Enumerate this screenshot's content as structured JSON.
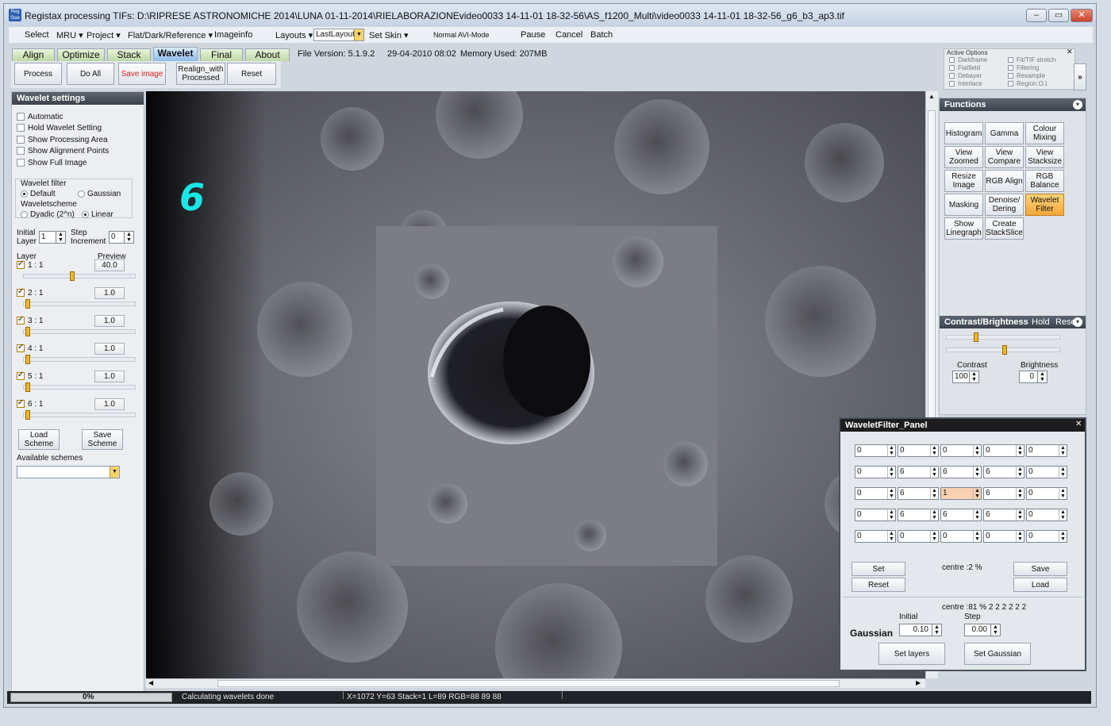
{
  "window": {
    "title": "Registax processing TIFs: D:\\RIPRESE ASTRONOMICHE 2014\\LUNA 01-11-2014\\RIELABORAZIONEvideo0033 14-11-01 18-32-56\\AS_f1200_Multi\\video0033 14-11-01 18-32-56_g6_b3_ap3.tif",
    "minimize": "‒",
    "maximize": "▭",
    "close": "✕"
  },
  "menu": {
    "select": "Select",
    "mru": "MRU ▾",
    "project": "Project ▾",
    "flat": "Flat/Dark/Reference ▾",
    "imageinfo": "Imageinfo",
    "layouts": "Layouts ▾",
    "layout_value": "LastLayout",
    "setskin": "Set Skin ▾",
    "avi": "Normal AVI-Mode",
    "pause": "Pause",
    "cancel": "Cancel",
    "batch": "Batch"
  },
  "tabs": [
    "Align",
    "Optimize",
    "Stack",
    "Wavelet",
    "Final",
    "About"
  ],
  "info": {
    "version": "File Version: 5.1.9.2",
    "date": "29-04-2010 08:02",
    "memory": "Memory Used: 207MB"
  },
  "toolbar": {
    "process": "Process",
    "doall": "Do All",
    "save": "Save image",
    "realign": "Realign_with Processed",
    "reset": "Reset"
  },
  "active_options": {
    "title": "Active Options",
    "left": [
      "Darkframe",
      "Flatfield",
      "Debayer",
      "Interlace"
    ],
    "right": [
      "Fit/TIF stretch",
      "Filtering",
      "Resample",
      "Region.O.I."
    ],
    "more": "»"
  },
  "wavelet": {
    "title": "Wavelet settings",
    "checks": [
      "Automatic",
      "Hold Wavelet Setting",
      "Show Processing Area",
      "Show Alignment Points",
      "Show Full Image"
    ],
    "filter_label": "Wavelet filter",
    "default": "Default",
    "gaussian": "Gaussian",
    "scheme_label": "Waveletscheme",
    "dyadic": "Dyadic (2^n)",
    "linear": "Linear",
    "initial_layer": "Initial Layer",
    "initial_val": "1",
    "step_inc": "Step Increment",
    "step_val": "0",
    "layer": "Layer",
    "preview": "Preview",
    "layers": [
      {
        "label": "1 : 1",
        "value": "40.0",
        "pos": 0.42
      },
      {
        "label": "2 : 1",
        "value": "1.0",
        "pos": 0.0
      },
      {
        "label": "3 : 1",
        "value": "1.0",
        "pos": 0.0
      },
      {
        "label": "4 : 1",
        "value": "1.0",
        "pos": 0.0
      },
      {
        "label": "5 : 1",
        "value": "1.0",
        "pos": 0.0
      },
      {
        "label": "6 : 1",
        "value": "1.0",
        "pos": 0.0
      }
    ],
    "load": "Load Scheme",
    "save": "Save Scheme",
    "available": "Available schemes"
  },
  "overlay_number": "6",
  "functions": {
    "title": "Functions",
    "buttons": [
      "Histogram",
      "Gamma",
      "Colour Mixing",
      "View Zoomed",
      "View Compare",
      "View Stacksize",
      "Resize Image",
      "RGB Align",
      "RGB Balance",
      "Masking",
      "Denoise/ Dering",
      "Wavelet Filter",
      "Show Linegraph",
      "Create StackSlice"
    ]
  },
  "contrast": {
    "title": "Contrast/Brightness",
    "hold": "Hold",
    "reset": "Reset",
    "contrast_label": "Contrast",
    "contrast_val": "100",
    "brightness_label": "Brightness",
    "brightness_val": "0"
  },
  "wfpanel": {
    "title": "WaveletFilter_Panel",
    "close": "✕",
    "matrix": [
      [
        "0",
        "0",
        "0",
        "0",
        "0"
      ],
      [
        "0",
        "6",
        "6",
        "6",
        "0"
      ],
      [
        "0",
        "6",
        "1",
        "6",
        "0"
      ],
      [
        "0",
        "6",
        "6",
        "6",
        "0"
      ],
      [
        "0",
        "0",
        "0",
        "0",
        "0"
      ]
    ],
    "set": "Set",
    "reset": "Reset",
    "centre1": "centre :2 %",
    "save": "Save",
    "load": "Load",
    "centre2": "centre :81 % 2 2 2 2 2 2",
    "initial": "Initial",
    "step": "Step",
    "gaussian": "Gaussian",
    "init_val": "0.10",
    "step_val": "0.00",
    "set_layers": "Set layers",
    "set_gaussian": "Set Gaussian"
  },
  "status": {
    "progress": "0%",
    "message": "Calculating wavelets done",
    "coords": "X=1072 Y=63 Stack=1 L=89 RGB=88 89 88"
  },
  "colors": {
    "accent": "#f4a73a",
    "overlay": "#19e6e6"
  }
}
